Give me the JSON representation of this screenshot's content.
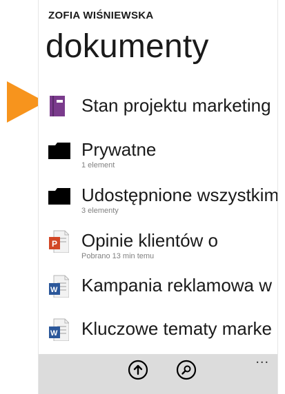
{
  "header": {
    "owner": "ZOFIA WIŚNIEWSKA",
    "title": "dokumenty"
  },
  "items": [
    {
      "name": "Stan projektu marketing",
      "subtitle": "",
      "icon": "onenote-notebook-icon",
      "color": "#7a3b8c"
    },
    {
      "name": "Prywatne",
      "subtitle": "1 element",
      "icon": "folder-icon",
      "color": "#000000"
    },
    {
      "name": "Udostępnione wszystkim",
      "subtitle": "3 elementy",
      "icon": "folder-icon",
      "color": "#000000"
    },
    {
      "name": "Opinie klientów o",
      "subtitle": "Pobrano 13 min temu",
      "icon": "powerpoint-document-icon",
      "color": "#d24726"
    },
    {
      "name": "Kampania reklamowa w",
      "subtitle": "",
      "icon": "word-document-icon",
      "color": "#2b579a"
    },
    {
      "name": "Kluczowe tematy marke",
      "subtitle": "",
      "icon": "word-document-icon",
      "color": "#2b579a"
    }
  ],
  "appbar": {
    "buttons": [
      "upload-icon",
      "search-icon"
    ],
    "more": "..."
  },
  "colors": {
    "arrow": "#f7941d",
    "appbar": "#dcdcdc"
  }
}
